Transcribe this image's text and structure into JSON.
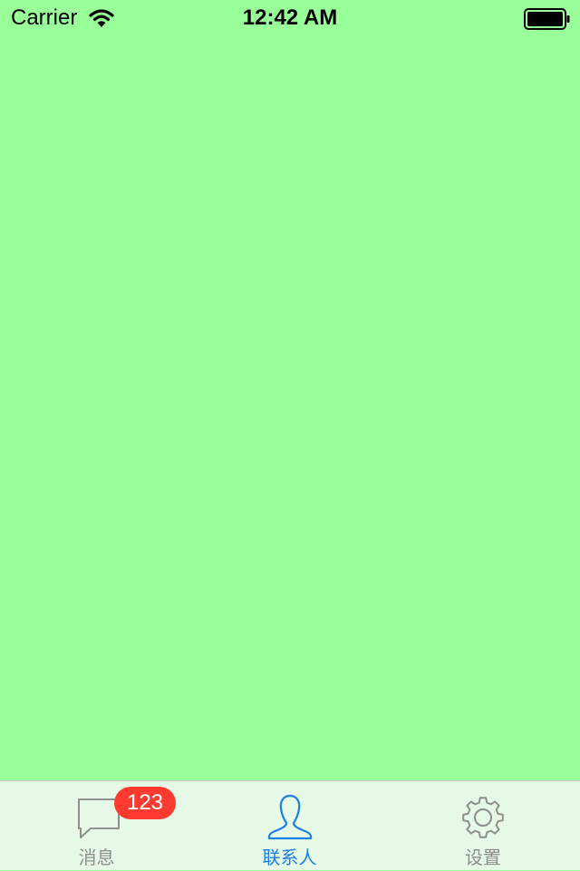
{
  "status_bar": {
    "carrier": "Carrier",
    "time": "12:42 AM",
    "wifi_icon": "wifi-icon",
    "battery_icon": "battery-icon"
  },
  "content": {
    "background_color": "#99FF99"
  },
  "tab_bar": {
    "selected": "联系人",
    "active_color": "#1A7FE8",
    "inactive_color": "#8E8E8E",
    "tabs": [
      {
        "label": "消息",
        "icon": "chat-bubble-icon",
        "badge": "123"
      },
      {
        "label": "联系人",
        "icon": "person-icon"
      },
      {
        "label": "设置",
        "icon": "gear-icon"
      }
    ]
  }
}
